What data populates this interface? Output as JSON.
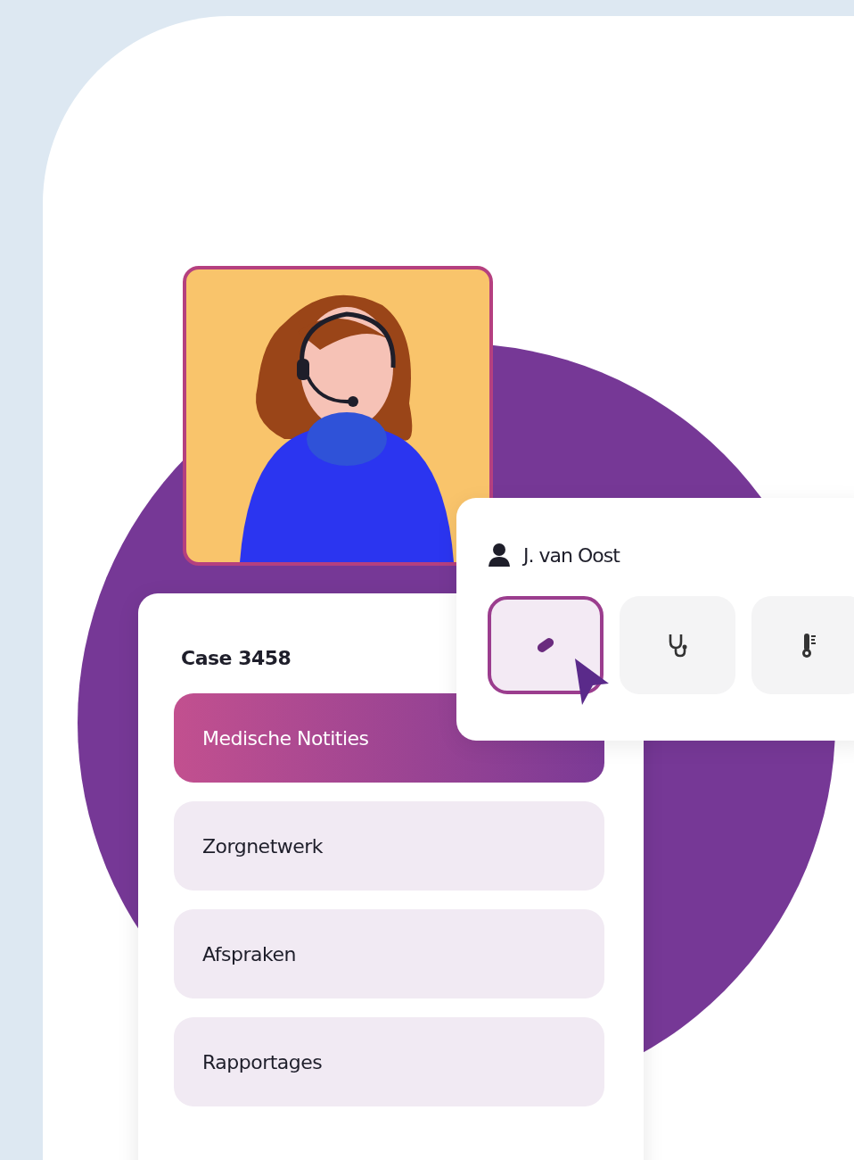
{
  "person_card": {
    "name": "J. van Oost",
    "tools": [
      {
        "kind": "pill",
        "selected": true
      },
      {
        "kind": "stethoscope",
        "selected": false
      },
      {
        "kind": "thermometer",
        "selected": false
      }
    ]
  },
  "case_card": {
    "title": "Case 3458",
    "menu": [
      {
        "label": "Medische Notities",
        "selected": true
      },
      {
        "label": "Zorgnetwerk",
        "selected": false
      },
      {
        "label": "Afspraken",
        "selected": false
      },
      {
        "label": "Rapportages",
        "selected": false
      }
    ]
  }
}
